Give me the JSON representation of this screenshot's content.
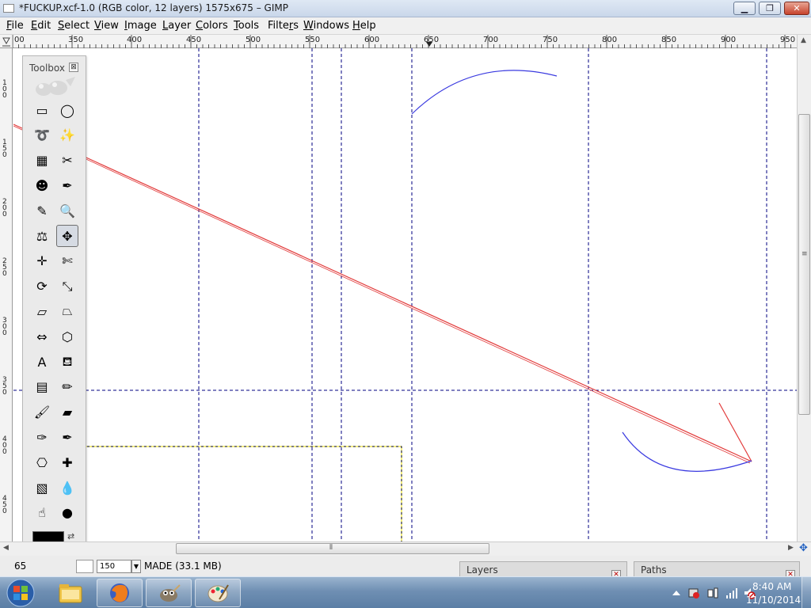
{
  "window": {
    "title": "*FUCKUP.xcf-1.0 (RGB color, 12 layers) 1575x675 – GIMP",
    "minimize": "▁",
    "maximize": "❐",
    "close": "✕"
  },
  "menubar": {
    "items": [
      {
        "label": "File",
        "key": "F",
        "rest": "ile"
      },
      {
        "label": "Edit",
        "key": "E",
        "rest": "dit"
      },
      {
        "label": "Select",
        "key": "S",
        "rest": "elect"
      },
      {
        "label": "View",
        "key": "V",
        "rest": "iew"
      },
      {
        "label": "Image",
        "key": "I",
        "rest": "mage"
      },
      {
        "label": "Layer",
        "key": "L",
        "rest": "ayer"
      },
      {
        "label": "Colors",
        "key": "C",
        "rest": "olors"
      },
      {
        "label": "Tools",
        "key": "T",
        "rest": "ools"
      },
      {
        "label": "Filters",
        "key": "r",
        "prefix": "Filte",
        "rest": "s"
      },
      {
        "label": "Windows",
        "key": "W",
        "rest": "indows"
      },
      {
        "label": "Help",
        "key": "H",
        "rest": "elp"
      }
    ]
  },
  "rulers": {
    "top_labels": [
      "00",
      "350",
      "400",
      "450",
      "500",
      "550",
      "600",
      "650",
      "700",
      "750",
      "800",
      "850",
      "900",
      "950"
    ],
    "left_labels": [
      "100",
      "150",
      "200",
      "250",
      "300",
      "350",
      "400",
      "450"
    ]
  },
  "toolbox": {
    "title": "Toolbox",
    "close": "⊠",
    "tools": [
      {
        "name": "rect-select-tool",
        "glyph": "▭"
      },
      {
        "name": "ellipse-select-tool",
        "glyph": "◯"
      },
      {
        "name": "free-select-tool",
        "glyph": "➰"
      },
      {
        "name": "fuzzy-select-tool",
        "glyph": "✨"
      },
      {
        "name": "select-by-color-tool",
        "glyph": "▦"
      },
      {
        "name": "scissors-select-tool",
        "glyph": "✂"
      },
      {
        "name": "foreground-select-tool",
        "glyph": "☻"
      },
      {
        "name": "paths-tool",
        "glyph": "✒"
      },
      {
        "name": "color-picker-tool",
        "glyph": "✎"
      },
      {
        "name": "zoom-tool",
        "glyph": "🔍"
      },
      {
        "name": "measure-tool",
        "glyph": "⚖"
      },
      {
        "name": "move-tool",
        "glyph": "✥"
      },
      {
        "name": "align-tool",
        "glyph": "✛"
      },
      {
        "name": "crop-tool",
        "glyph": "✄"
      },
      {
        "name": "rotate-tool",
        "glyph": "⟳"
      },
      {
        "name": "scale-tool",
        "glyph": "⤡"
      },
      {
        "name": "shear-tool",
        "glyph": "▱"
      },
      {
        "name": "perspective-tool",
        "glyph": "⏢"
      },
      {
        "name": "flip-tool",
        "glyph": "⇔"
      },
      {
        "name": "cage-transform-tool",
        "glyph": "⬡"
      },
      {
        "name": "text-tool",
        "glyph": "A"
      },
      {
        "name": "bucket-fill-tool",
        "glyph": "⛾"
      },
      {
        "name": "blend-tool",
        "glyph": "▤"
      },
      {
        "name": "pencil-tool",
        "glyph": "✏"
      },
      {
        "name": "paintbrush-tool",
        "glyph": "🖌"
      },
      {
        "name": "eraser-tool",
        "glyph": "▰"
      },
      {
        "name": "airbrush-tool",
        "glyph": "✑"
      },
      {
        "name": "ink-tool",
        "glyph": "✒"
      },
      {
        "name": "clone-tool",
        "glyph": "⎔"
      },
      {
        "name": "heal-tool",
        "glyph": "✚"
      },
      {
        "name": "perspective-clone-tool",
        "glyph": "▧"
      },
      {
        "name": "blur-sharpen-tool",
        "glyph": "💧"
      },
      {
        "name": "smudge-tool",
        "glyph": "☝"
      },
      {
        "name": "dodge-burn-tool",
        "glyph": "●"
      }
    ]
  },
  "statusbar": {
    "coord": "65",
    "zoom": "150",
    "message": "MADE (33.1 MB)"
  },
  "docks": {
    "layers_label": "Layers",
    "paths_label": "Paths",
    "close": "✕"
  },
  "taskbar": {
    "time": "8:40 AM",
    "date": "11/10/2014"
  },
  "colors": {
    "guide": "#0000a0",
    "red_line": "#e23a3a",
    "blue_curve": "#3a3ae0",
    "selection": "#d6c800"
  }
}
